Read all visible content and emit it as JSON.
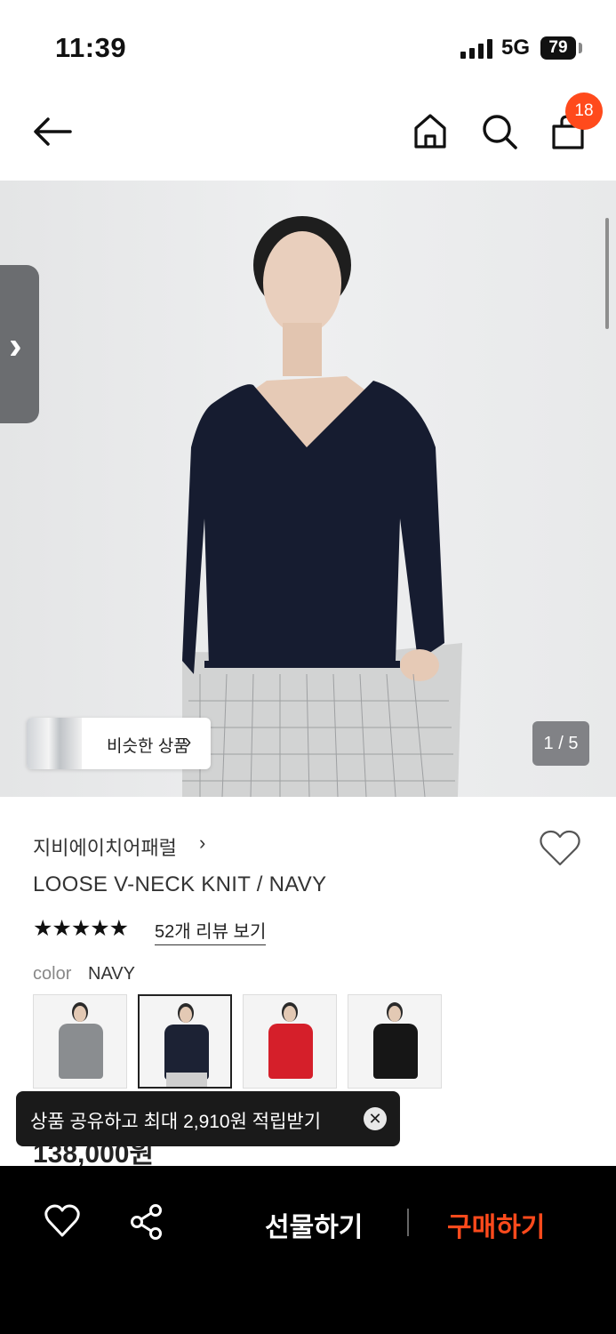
{
  "status_bar": {
    "time": "11:39",
    "network": "5G",
    "battery": "79"
  },
  "nav": {
    "cart_count": "18",
    "icons": [
      "back-arrow-icon",
      "home-icon",
      "search-icon",
      "shopping-bag-icon"
    ]
  },
  "gallery": {
    "similar_label": "비슷한 상품",
    "pager": "1 / 5",
    "chevron": "›",
    "similar_chevron": "›"
  },
  "product": {
    "brand": "지비에이치어패럴",
    "brand_chevron": "›",
    "name": "LOOSE V-NECK KNIT / NAVY",
    "rating_stars": "★★★★★",
    "rating": 5,
    "reviews_link": "52개 리뷰 보기",
    "color_label": "color",
    "color_value": "NAVY",
    "swatches": [
      {
        "name": "gray",
        "color": "#8a8d90",
        "selected": false
      },
      {
        "name": "navy",
        "color": "#1c2234",
        "selected": true
      },
      {
        "name": "red",
        "color": "#d51f2a",
        "selected": false
      },
      {
        "name": "black",
        "color": "#161616",
        "selected": false
      }
    ],
    "price": "138,000원"
  },
  "toast": {
    "text": "상품 공유하고 최대 2,910원 적립받기",
    "close": "✕"
  },
  "bottom_bar": {
    "gift_label": "선물하기",
    "buy_label": "구매하기",
    "accent_color": "#ff4a1c"
  }
}
